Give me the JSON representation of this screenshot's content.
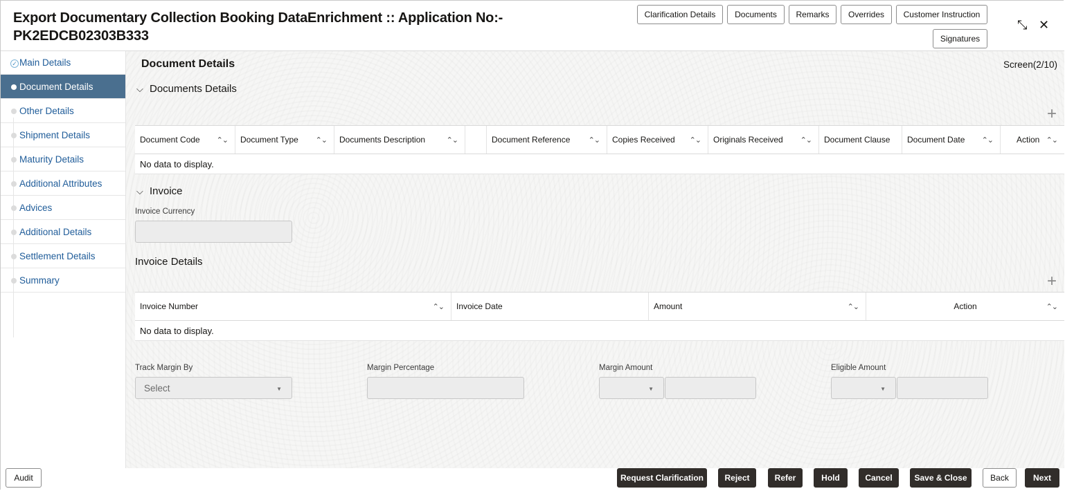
{
  "header": {
    "title_line1": "Export Documentary Collection Booking DataEnrichment :: Application No:-",
    "title_line2": "PK2EDCB02303B333",
    "buttons": [
      "Clarification Details",
      "Documents",
      "Remarks",
      "Overrides",
      "Customer Instruction",
      "Signatures"
    ],
    "minimize_glyph": "⤡",
    "close_glyph": "✕"
  },
  "sidebar": {
    "items": [
      {
        "label": "Main Details",
        "state": "done"
      },
      {
        "label": "Document Details",
        "state": "active"
      },
      {
        "label": "Other Details",
        "state": ""
      },
      {
        "label": "Shipment Details",
        "state": ""
      },
      {
        "label": "Maturity Details",
        "state": ""
      },
      {
        "label": "Additional Attributes",
        "state": ""
      },
      {
        "label": "Advices",
        "state": ""
      },
      {
        "label": "Additional Details",
        "state": ""
      },
      {
        "label": "Settlement Details",
        "state": ""
      },
      {
        "label": "Summary",
        "state": ""
      }
    ]
  },
  "main": {
    "page_title": "Document Details",
    "screen_indicator": "Screen(2/10)",
    "documents_section": {
      "title": "Documents Details",
      "columns": [
        "Document Code",
        "Document Type",
        "Documents Description",
        "",
        "Document Reference",
        "Copies Received",
        "Originals Received",
        "Document Clause",
        "Document Date",
        "Action"
      ],
      "empty_text": "No data to display."
    },
    "invoice_section": {
      "title": "Invoice",
      "currency_label": "Invoice Currency",
      "currency_value": ""
    },
    "invoice_details": {
      "title": "Invoice Details",
      "columns": [
        "Invoice Number",
        "Invoice Date",
        "Amount",
        "Action"
      ],
      "empty_text": "No data to display."
    },
    "margin": {
      "track_margin_label": "Track Margin By",
      "track_margin_value": "Select",
      "margin_percentage_label": "Margin Percentage",
      "margin_amount_label": "Margin Amount",
      "eligible_amount_label": "Eligible Amount"
    }
  },
  "footer": {
    "audit": "Audit",
    "buttons": [
      "Request Clarification",
      "Reject",
      "Refer",
      "Hold",
      "Cancel",
      "Save & Close",
      "Back",
      "Next"
    ]
  }
}
